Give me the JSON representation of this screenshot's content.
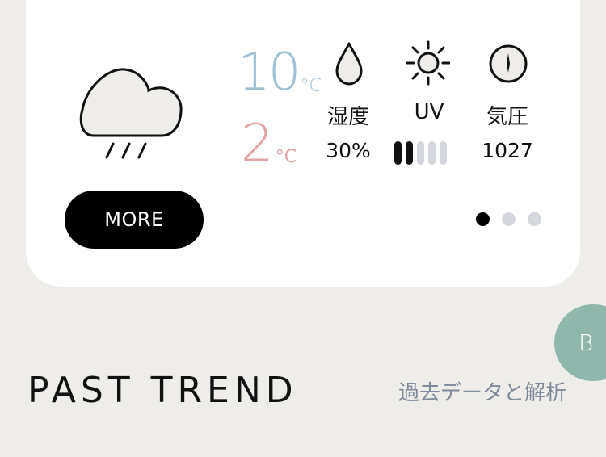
{
  "weather_card": {
    "icon": "rain-cloud-icon",
    "temp_high": "10",
    "temp_low": "2",
    "unit": "°C",
    "stats": {
      "humidity": {
        "icon": "droplet-icon",
        "label": "湿度",
        "value": "30%"
      },
      "uv": {
        "icon": "sun-icon",
        "label": "UV",
        "level": 2,
        "max": 5
      },
      "pressure": {
        "icon": "compass-icon",
        "label": "気圧",
        "value": "1027"
      }
    },
    "more_label": "MORE",
    "pagination": {
      "count": 3,
      "active": 0
    }
  },
  "fab": {
    "label": "B"
  },
  "section": {
    "title": "PAST TREND",
    "subtitle": "過去データと解析"
  },
  "colors": {
    "background": "#eeedea",
    "card": "#ffffff",
    "temp_high": "#9fc0d6",
    "temp_low": "#e0a3a6",
    "fab": "#8fb7ac",
    "subtitle": "#7f8a9a"
  }
}
